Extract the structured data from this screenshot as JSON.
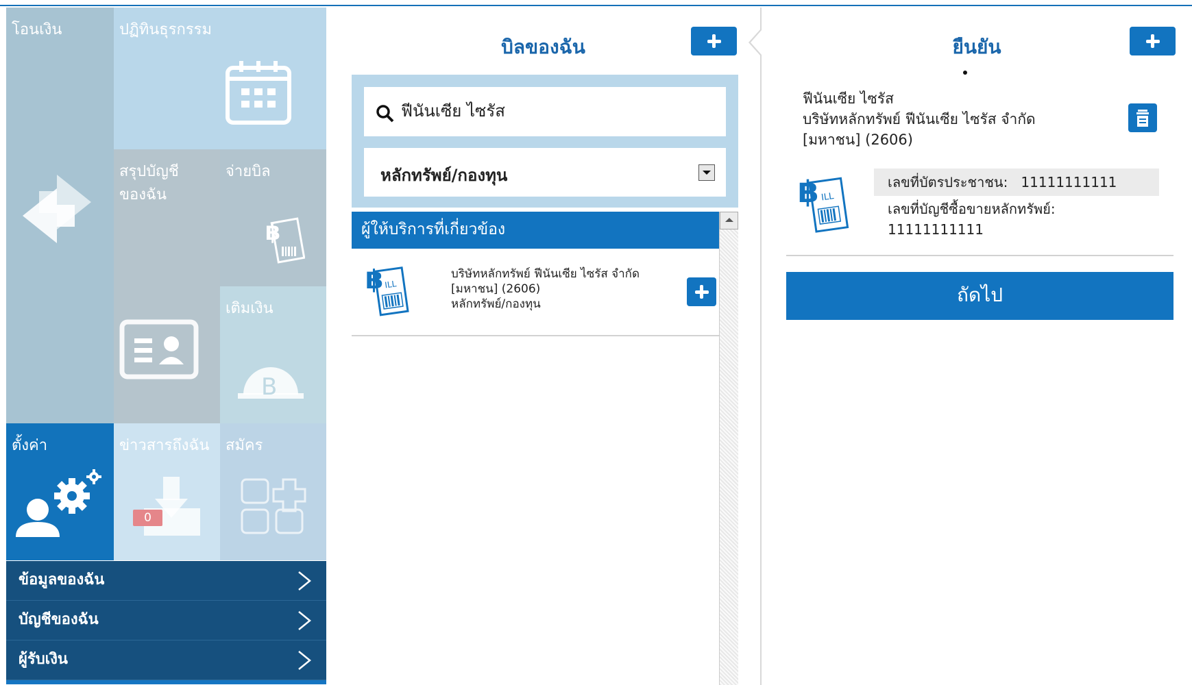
{
  "tiles": {
    "transfer": "โอนเงิน",
    "activity": "ปฏิทินธุรกรรม",
    "summary": "สรุปบัญชี\nของฉัน",
    "paybill": "จ่ายบิล",
    "topup": "เติมเงิน",
    "settings": "ตั้งค่า",
    "news": "ข่าวสารถึงฉัน",
    "news_badge": "0",
    "register": "สมัคร"
  },
  "settings_menu": {
    "items": [
      {
        "label": "ข้อมูลของฉัน"
      },
      {
        "label": "บัญชีของฉัน"
      },
      {
        "label": "ผู้รับเงิน"
      }
    ]
  },
  "my_bills": {
    "title": "บิลของฉัน",
    "search_value": "ฟีนันเซีย ไซรัส",
    "category_selected": "หลักทรัพย์/กองทุน",
    "providers_header": "ผู้ให้บริการที่เกี่ยวข้อง",
    "providers": [
      {
        "name": "บริษัทหลักทรัพย์ ฟีนันเซีย ไซรัส จำกัด",
        "code": "[มหาชน] (2606)",
        "category": "หลักทรัพย์/กองทุน"
      }
    ]
  },
  "confirm": {
    "title": "ยืนยัน",
    "biller_short": "ฟีนันเซีย ไซรัส",
    "biller_full": "บริษัทหลักทรัพย์ ฟีนันเซีย ไซรัส จำกัด",
    "biller_code": "[มหาชน] (2606)",
    "id_label": "เลขที่บัตรประชาชน:",
    "id_value": "11111111111",
    "account_label": "เลขที่บัญชีซื้อขายหลักทรัพย์:",
    "account_value": "11111111111",
    "next_label": "ถัดไป"
  },
  "colors": {
    "primary": "#1274c0",
    "title_blue": "#1a66ab",
    "menu_dark": "#16507e"
  },
  "icons": [
    "transfer-icon",
    "calendar-icon",
    "id-card-icon",
    "bill-icon",
    "coin-icon",
    "gears-icon",
    "inbox-icon",
    "apps-plus-icon",
    "chevron-right-icon",
    "search-icon",
    "trash-icon",
    "plus-icon"
  ]
}
